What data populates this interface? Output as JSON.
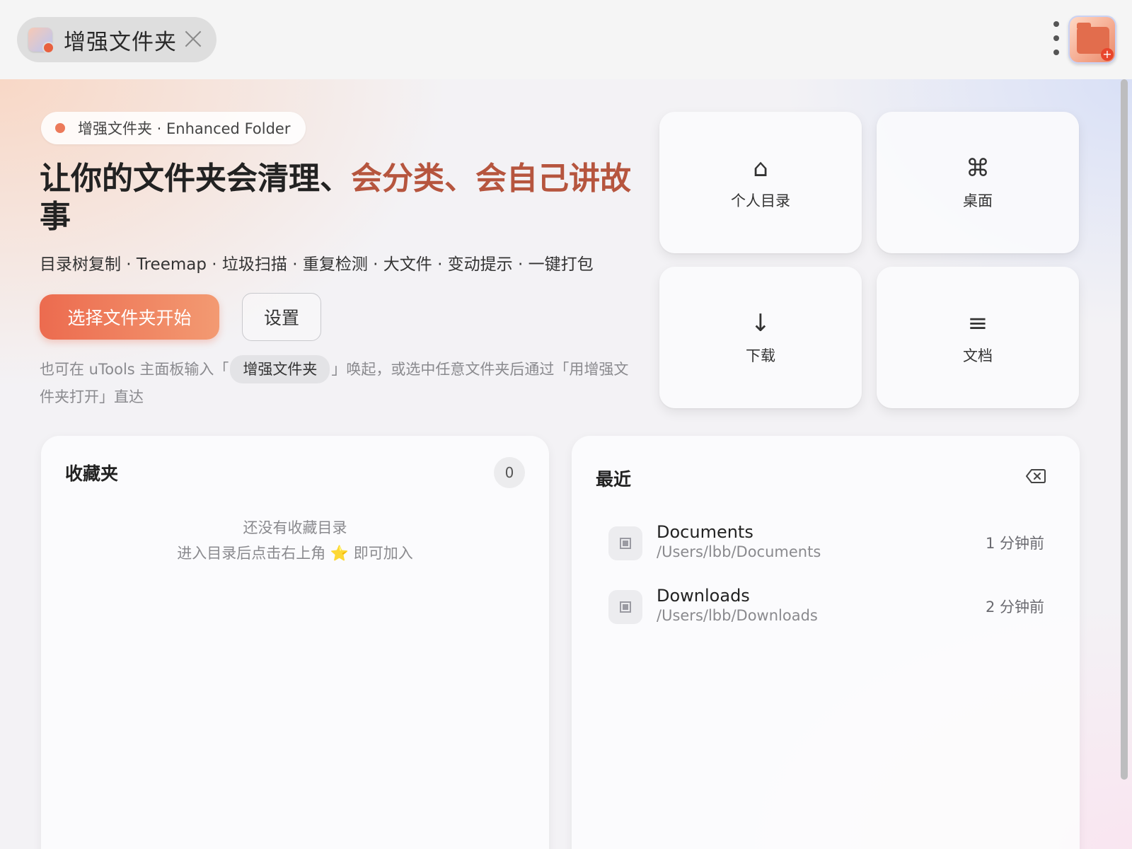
{
  "tab": {
    "title": "增强文件夹"
  },
  "hero": {
    "badge": "增强文件夹 · Enhanced Folder",
    "headline_plain": "让你的文件夹会清理、",
    "headline_accent": "会分类、会自己讲故",
    "headline_tail": "事",
    "subtitle": "目录树复制 · Treemap · 垃圾扫描 · 重复检测 · 大文件 · 变动提示 · 一键打包",
    "primary_button": "选择文件夹开始",
    "secondary_button": "设置",
    "hint_before": "也可在 uTools 主面板输入「",
    "hint_chip": "增强文件夹",
    "hint_after": "」唤起，或选中任意文件夹后通过「用增强文件夹打开」直达"
  },
  "quick_tiles": [
    {
      "icon": "home-icon",
      "glyph": "⌂",
      "label": "个人目录"
    },
    {
      "icon": "command-icon",
      "glyph": "⌘",
      "label": "桌面"
    },
    {
      "icon": "download-arrow-icon",
      "glyph": "↓",
      "label": "下载"
    },
    {
      "icon": "document-lines-icon",
      "glyph": "≡",
      "label": "文档"
    }
  ],
  "favorites": {
    "title": "收藏夹",
    "count": "0",
    "empty_line1": "还没有收藏目录",
    "empty_line2": "进入目录后点击右上角 ⭐ 即可加入"
  },
  "recent": {
    "title": "最近",
    "items": [
      {
        "name": "Documents",
        "path": "/Users/lbb/Documents",
        "time": "1 分钟前"
      },
      {
        "name": "Downloads",
        "path": "/Users/lbb/Downloads",
        "time": "2 分钟前"
      }
    ]
  },
  "colors": {
    "accent": "#ec6b4f",
    "headline_accent": "#b6553e",
    "badge_dot": "#ec7a5a"
  }
}
